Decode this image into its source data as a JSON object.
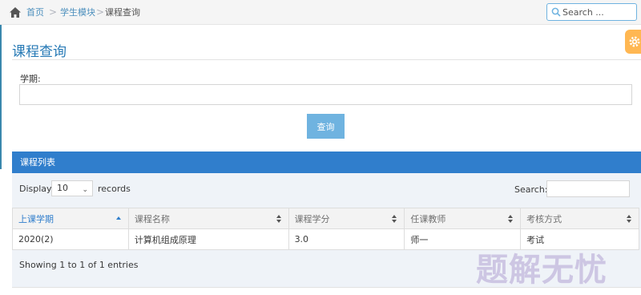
{
  "breadcrumb": {
    "home": "首页",
    "module": "学生模块",
    "current": "课程查询",
    "separator": ">"
  },
  "top_search": {
    "placeholder": "Search ..."
  },
  "page": {
    "title": "课程查询"
  },
  "form": {
    "term_label": "学期:",
    "term_value": "",
    "query_button": "查询"
  },
  "panel": {
    "title": "课程列表"
  },
  "table_controls": {
    "display_label": "Display",
    "page_length": "10",
    "records_label": "records",
    "search_label": "Search:",
    "search_value": ""
  },
  "table": {
    "columns": [
      "上课学期",
      "课程名称",
      "课程学分",
      "任课教师",
      "考核方式"
    ],
    "rows": [
      [
        "2020(2)",
        "计算机组成原理",
        "3.0",
        "师一",
        "考试"
      ]
    ]
  },
  "info_text": "Showing 1 to 1 of 1 entries",
  "watermark": "题解无忧",
  "colors": {
    "accent": "#307ecc",
    "link": "#4c8fbd",
    "button": "#6fb3e0",
    "settings": "#ffb752"
  }
}
